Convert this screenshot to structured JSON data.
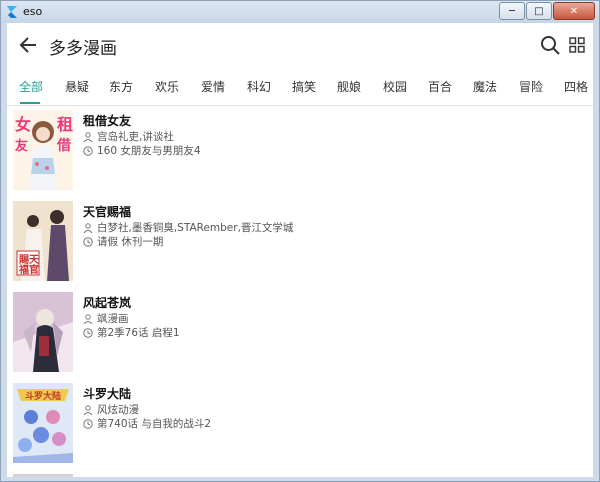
{
  "window": {
    "title": "eso",
    "controls": [
      "─",
      "□",
      "✕"
    ]
  },
  "appbar": {
    "title": "多多漫画"
  },
  "tabs": [
    "全部",
    "悬疑",
    "东方",
    "欢乐",
    "爱情",
    "科幻",
    "搞笑",
    "舰娘",
    "校园",
    "百合",
    "魔法",
    "冒险",
    "四格"
  ],
  "active_tab": 0,
  "comics": [
    {
      "name": "租借女友",
      "author": "宫岛礼吏,讲谈社",
      "chapter": "160 女朋友与男朋友4"
    },
    {
      "name": "天官赐福",
      "author": "白梦社,墨香铜臭,STARember,晋江文学城",
      "chapter": "请假 休刊一期"
    },
    {
      "name": "风起苍岚",
      "author": "飒漫画",
      "chapter": "第2季76话 启程1"
    },
    {
      "name": "斗罗大陆",
      "author": "风炫动漫",
      "chapter": "第740话 与自我的战斗2"
    }
  ],
  "colors": {
    "accent": "#2a9d8f",
    "text": "#222222",
    "meta": "#555555"
  },
  "icons": {
    "back": "arrow-left-icon",
    "search": "search-icon",
    "grid": "grid-view-icon",
    "author": "person-icon",
    "chapter": "clock-icon"
  }
}
